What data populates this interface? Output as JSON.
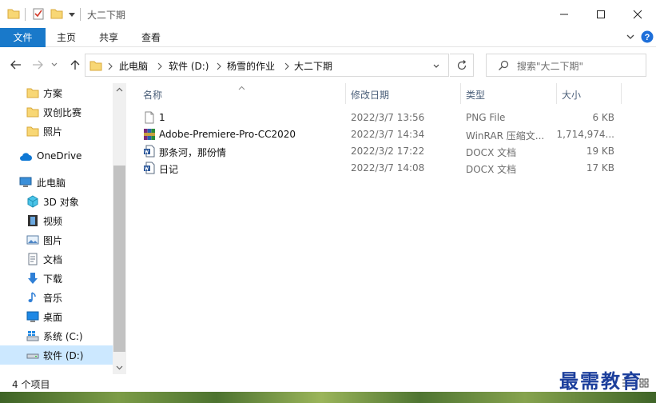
{
  "window": {
    "title": "大二下期",
    "controls": {
      "minimize": "—",
      "maximize": "☐",
      "close": "✕"
    }
  },
  "ribbon": {
    "tabs": [
      "文件",
      "主页",
      "共享",
      "查看"
    ],
    "help_label": "?"
  },
  "address": {
    "crumbs": [
      "此电脑",
      "软件 (D:)",
      "杨雪的作业",
      "大二下期"
    ]
  },
  "search": {
    "placeholder": "搜索\"大二下期\""
  },
  "nav": {
    "quick_access": [
      {
        "label": "方案",
        "icon": "folder-icon"
      },
      {
        "label": "双创比赛",
        "icon": "folder-icon"
      },
      {
        "label": "照片",
        "icon": "folder-icon"
      }
    ],
    "onedrive": {
      "label": "OneDrive",
      "icon": "cloud-icon"
    },
    "this_pc": {
      "label": "此电脑",
      "icon": "computer-icon"
    },
    "this_pc_items": [
      {
        "label": "3D 对象",
        "icon": "cube-icon"
      },
      {
        "label": "视频",
        "icon": "film-icon"
      },
      {
        "label": "图片",
        "icon": "picture-icon"
      },
      {
        "label": "文档",
        "icon": "document-icon"
      },
      {
        "label": "下载",
        "icon": "download-arrow-icon"
      },
      {
        "label": "音乐",
        "icon": "music-note-icon"
      },
      {
        "label": "桌面",
        "icon": "desktop-icon"
      },
      {
        "label": "系统 (C:)",
        "icon": "windows-drive-icon"
      },
      {
        "label": "软件 (D:)",
        "icon": "drive-icon"
      }
    ],
    "selected": "软件 (D:)"
  },
  "columns": {
    "name": "名称",
    "date": "修改日期",
    "type": "类型",
    "size": "大小"
  },
  "files": [
    {
      "name": "1",
      "date": "2022/3/7 13:56",
      "type": "PNG File",
      "size": "6 KB",
      "icon": "png-file-icon"
    },
    {
      "name": "Adobe-Premiere-Pro-CC2020",
      "date": "2022/3/7 14:34",
      "type": "WinRAR 压缩文...",
      "size": "1,714,974...",
      "icon": "winrar-archive-icon"
    },
    {
      "name": "那条河，那份情",
      "date": "2022/3/2 17:22",
      "type": "DOCX 文档",
      "size": "19 KB",
      "icon": "docx-file-icon"
    },
    {
      "name": "日记",
      "date": "2022/3/7 14:08",
      "type": "DOCX 文档",
      "size": "17 KB",
      "icon": "docx-file-icon"
    }
  ],
  "status": {
    "item_count": "4 个项目"
  },
  "watermark": "最需教育",
  "colors": {
    "file_tab": "#1979ca",
    "selected_nav": "#cce8ff",
    "help_circle": "#1e6fd9",
    "folder": "#f8d775",
    "watermark": "#1c3f9c"
  }
}
